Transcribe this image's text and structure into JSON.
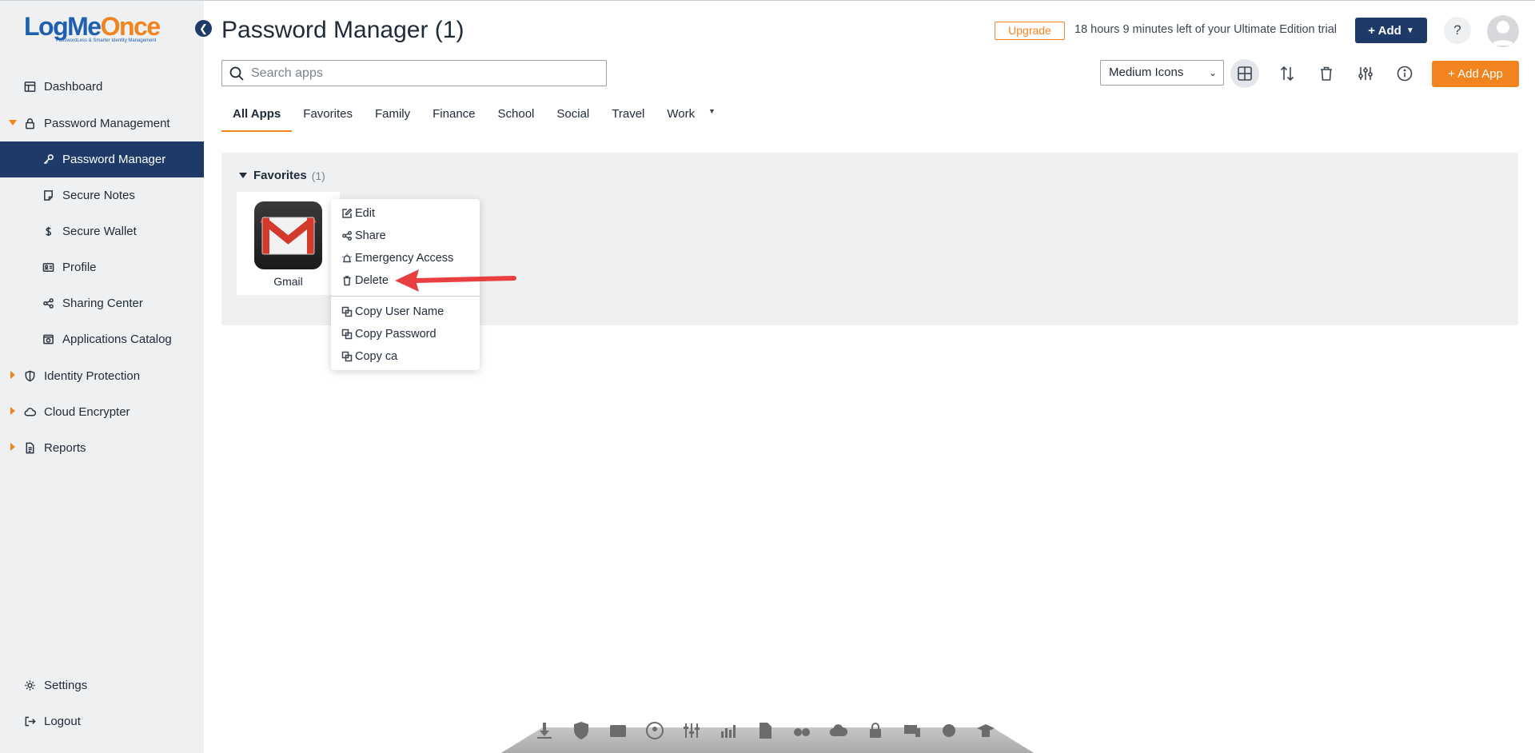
{
  "logo": {
    "part1": "LogMe",
    "part2": "Once",
    "tagline": "PasswordLess & Smarter Identity Management"
  },
  "sidebar": {
    "items": [
      {
        "label": "Dashboard",
        "icon": "dashboard-icon"
      },
      {
        "label": "Password Management",
        "icon": "lock-icon",
        "expanded": true
      },
      {
        "label": "Password Manager",
        "icon": "key-icon",
        "active": true
      },
      {
        "label": "Secure Notes",
        "icon": "note-icon"
      },
      {
        "label": "Secure Wallet",
        "icon": "dollar-icon"
      },
      {
        "label": "Profile",
        "icon": "id-card-icon"
      },
      {
        "label": "Sharing Center",
        "icon": "share-icon"
      },
      {
        "label": "Applications Catalog",
        "icon": "catalog-icon"
      },
      {
        "label": "Identity Protection",
        "icon": "shield-icon"
      },
      {
        "label": "Cloud Encrypter",
        "icon": "cloud-icon"
      },
      {
        "label": "Reports",
        "icon": "report-icon"
      }
    ],
    "settings": "Settings",
    "logout": "Logout"
  },
  "header": {
    "title": "Password Manager (1)",
    "upgrade": "Upgrade",
    "trial": "18 hours 9 minutes left of your Ultimate Edition trial",
    "add": "+ Add",
    "help": "?"
  },
  "toolbar": {
    "search_placeholder": "Search apps",
    "view_select": "Medium Icons",
    "add_app": "+ Add App"
  },
  "tabs": [
    "All Apps",
    "Favorites",
    "Family",
    "Finance",
    "School",
    "Social",
    "Travel",
    "Work"
  ],
  "favorites": {
    "title": "Favorites",
    "count": "(1)"
  },
  "app": {
    "name": "Gmail"
  },
  "context_menu": {
    "items": [
      "Edit",
      "Share",
      "Emergency Access",
      "Delete"
    ],
    "copy_items": [
      "Copy User Name",
      "Copy Password",
      "Copy ca"
    ]
  },
  "colors": {
    "navy": "#1d3a68",
    "orange": "#f2841f",
    "arrow": "#e84040"
  }
}
